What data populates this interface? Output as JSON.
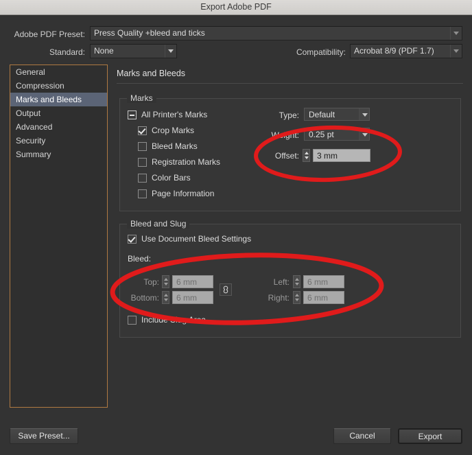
{
  "window": {
    "title": "Export Adobe PDF"
  },
  "top": {
    "preset_label": "Adobe PDF Preset:",
    "preset_value": "Press Quality +bleed and ticks",
    "standard_label": "Standard:",
    "standard_value": "None",
    "compatibility_label": "Compatibility:",
    "compatibility_value": "Acrobat 8/9 (PDF 1.7)"
  },
  "sidebar": {
    "items": [
      {
        "label": "General",
        "selected": false
      },
      {
        "label": "Compression",
        "selected": false
      },
      {
        "label": "Marks and Bleeds",
        "selected": true
      },
      {
        "label": "Output",
        "selected": false
      },
      {
        "label": "Advanced",
        "selected": false
      },
      {
        "label": "Security",
        "selected": false
      },
      {
        "label": "Summary",
        "selected": false
      }
    ]
  },
  "panel": {
    "title": "Marks and Bleeds",
    "marks": {
      "legend": "Marks",
      "all_printers_marks": "All Printer's Marks",
      "items": [
        {
          "label": "Crop Marks",
          "checked": true
        },
        {
          "label": "Bleed Marks",
          "checked": false
        },
        {
          "label": "Registration Marks",
          "checked": false
        },
        {
          "label": "Color Bars",
          "checked": false
        },
        {
          "label": "Page Information",
          "checked": false
        }
      ],
      "type_label": "Type:",
      "type_value": "Default",
      "weight_label": "Weight:",
      "weight_value": "0.25 pt",
      "offset_label": "Offset:",
      "offset_value": "3 mm"
    },
    "bleed": {
      "legend": "Bleed and Slug",
      "use_document_bleed": "Use Document Bleed Settings",
      "bleed_label": "Bleed:",
      "top_label": "Top:",
      "top_value": "6 mm",
      "bottom_label": "Bottom:",
      "bottom_value": "6 mm",
      "left_label": "Left:",
      "left_value": "6 mm",
      "right_label": "Right:",
      "right_value": "6 mm",
      "include_slug": "Include Slug Area"
    }
  },
  "footer": {
    "save_preset": "Save Preset...",
    "cancel": "Cancel",
    "export": "Export"
  },
  "annotation": {
    "color": "#e01b1b"
  }
}
